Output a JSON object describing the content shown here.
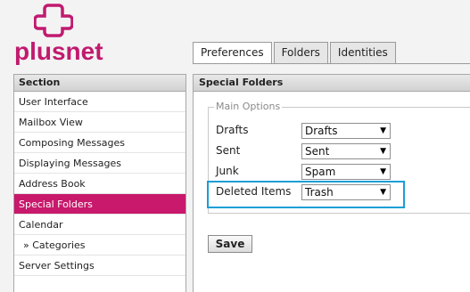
{
  "brand": {
    "name": "plusnet",
    "color": "#c11a6f"
  },
  "tabs": [
    {
      "label": "Preferences",
      "active": true
    },
    {
      "label": "Folders",
      "active": false
    },
    {
      "label": "Identities",
      "active": false
    }
  ],
  "section": {
    "title": "Section",
    "items": [
      {
        "label": "User Interface"
      },
      {
        "label": "Mailbox View"
      },
      {
        "label": "Composing Messages"
      },
      {
        "label": "Displaying Messages"
      },
      {
        "label": "Address Book"
      },
      {
        "label": "Special Folders",
        "active": true
      },
      {
        "label": "Calendar"
      },
      {
        "label": "» Categories"
      },
      {
        "label": "Server Settings"
      }
    ]
  },
  "main": {
    "title": "Special Folders",
    "group_label": "Main Options",
    "rows": [
      {
        "label": "Drafts",
        "value": "Drafts"
      },
      {
        "label": "Sent",
        "value": "Sent"
      },
      {
        "label": "Junk",
        "value": "Spam"
      },
      {
        "label": "Deleted Items",
        "value": "Trash"
      }
    ],
    "save_label": "Save"
  },
  "colors": {
    "accent": "#c8196c",
    "highlight": "#1a9ed6"
  }
}
